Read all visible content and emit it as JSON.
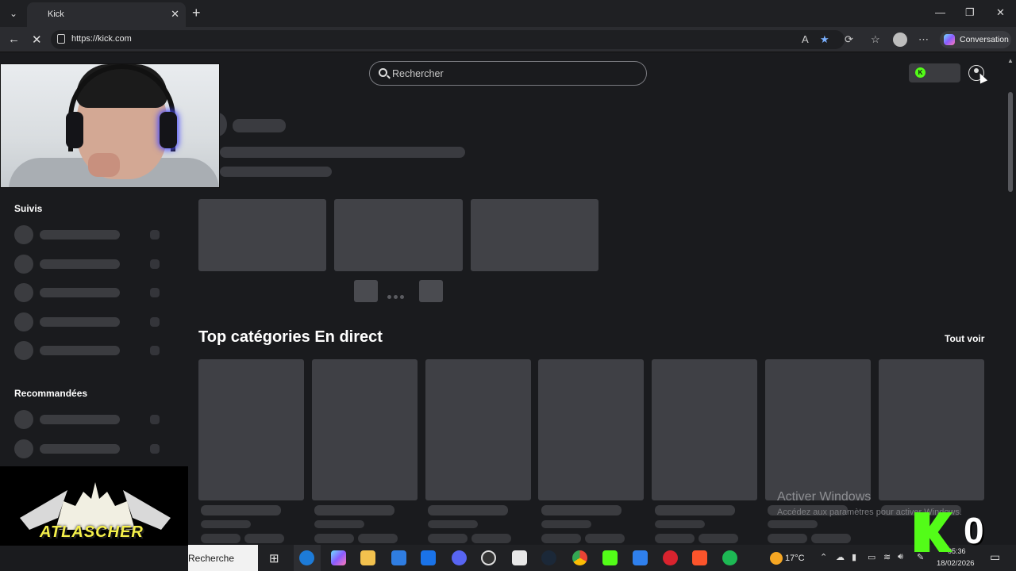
{
  "browser": {
    "tab_title": "Kick",
    "url": "https://kick.com",
    "copilot_label": "Conversation",
    "nav_icons": [
      "back-icon",
      "reload-icon"
    ],
    "window_controls": [
      "minimize-icon",
      "maximize-icon",
      "close-icon"
    ]
  },
  "header": {
    "search_placeholder": "Rechercher"
  },
  "sidebar": {
    "followed_title": "Suivis",
    "recommended_title": "Recommandées"
  },
  "main": {
    "top_categories_title": "Top catégories En direct",
    "see_all_label": "Tout voir"
  },
  "watermark": {
    "line1": "Activer Windows",
    "line2": "Accédez aux paramètres pour activer Windows."
  },
  "overlays": {
    "logo_text": "ATLASCHER",
    "kick_count": "0"
  },
  "taskbar": {
    "search_text": "Recherche",
    "temperature": "17°C",
    "time": "05:36",
    "date": "18/02/2026"
  },
  "colors": {
    "background": "#1a1b1e",
    "skeleton": "#3a3b40",
    "kick_green": "#53fc18"
  }
}
